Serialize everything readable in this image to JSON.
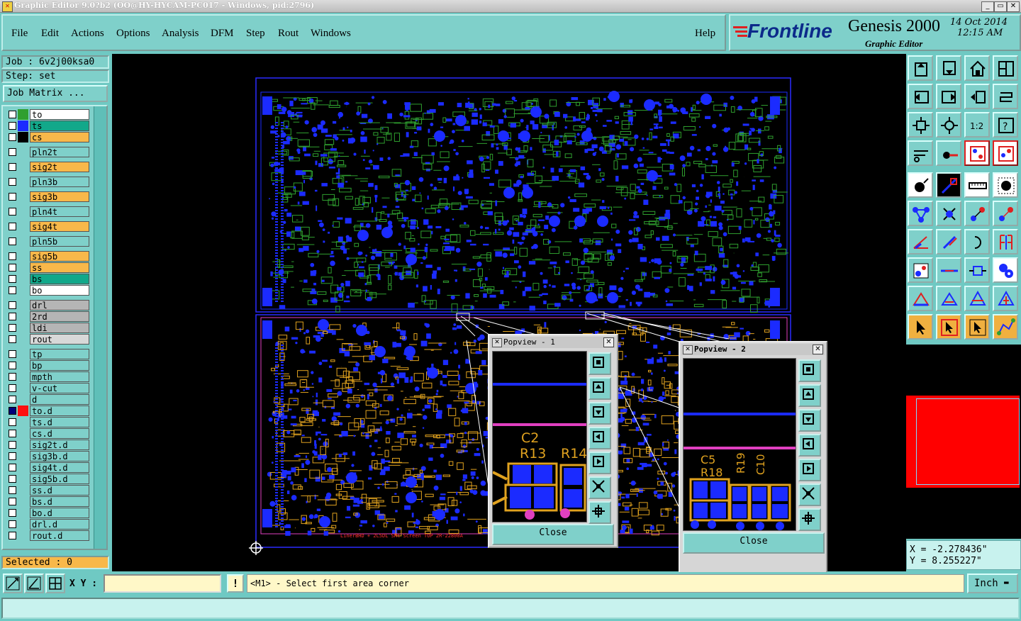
{
  "window": {
    "title": "Graphic Editor 9.0?b2 (OO@HY-HYCAM-PC017 - Windows, pid:2796)"
  },
  "menu": {
    "items": [
      "File",
      "Edit",
      "Actions",
      "Options",
      "Analysis",
      "DFM",
      "Step",
      "Rout",
      "Windows"
    ],
    "help": "Help"
  },
  "brand": {
    "logo": "Frontline",
    "product": "Genesis 2000",
    "subtitle": "Graphic Editor",
    "date": "14 Oct 2014",
    "time": "12:15 AM"
  },
  "job": {
    "job_label": "Job : 6v2j00ksa0",
    "step_label": "Step: set",
    "matrix_button": "Job Matrix ..."
  },
  "layers": [
    {
      "name": "to",
      "color": "#ffffff",
      "swatch": "#2f9f2f",
      "checked": false
    },
    {
      "name": "ts",
      "color": "#12a88a",
      "swatch": "#1b2bff",
      "checked": false
    },
    {
      "name": "cs",
      "color": "#f8b84a",
      "swatch": "#000000",
      "checked": false
    },
    {
      "name": "pln2t",
      "color": "#7fd0ca",
      "swatch": "",
      "checked": false
    },
    {
      "name": "sig2t",
      "color": "#f8b84a",
      "swatch": "",
      "checked": false
    },
    {
      "name": "pln3b",
      "color": "#7fd0ca",
      "swatch": "",
      "checked": false
    },
    {
      "name": "sig3b",
      "color": "#f8b84a",
      "swatch": "",
      "checked": false
    },
    {
      "name": "pln4t",
      "color": "#7fd0ca",
      "swatch": "",
      "checked": false
    },
    {
      "name": "sig4t",
      "color": "#f8b84a",
      "swatch": "",
      "checked": false
    },
    {
      "name": "pln5b",
      "color": "#7fd0ca",
      "swatch": "",
      "checked": false
    },
    {
      "name": "sig5b",
      "color": "#f8b84a",
      "swatch": "",
      "checked": false
    },
    {
      "name": "ss",
      "color": "#f8b84a",
      "swatch": "",
      "checked": false
    },
    {
      "name": "bs",
      "color": "#12a88a",
      "swatch": "",
      "checked": false
    },
    {
      "name": "bo",
      "color": "#ffffff",
      "swatch": "",
      "checked": false
    },
    {
      "name": "drl",
      "color": "#b5b5b5",
      "swatch": "",
      "checked": false
    },
    {
      "name": "2rd",
      "color": "#b5b5b5",
      "swatch": "",
      "checked": false
    },
    {
      "name": "ldi",
      "color": "#b5b5b5",
      "swatch": "",
      "checked": false
    },
    {
      "name": "rout",
      "color": "#d8d8d8",
      "swatch": "",
      "checked": false
    },
    {
      "name": "tp",
      "color": "#7fd0ca",
      "swatch": "",
      "checked": false
    },
    {
      "name": "bp",
      "color": "#7fd0ca",
      "swatch": "",
      "checked": false
    },
    {
      "name": "mpth",
      "color": "#7fd0ca",
      "swatch": "",
      "checked": false
    },
    {
      "name": "v-cut",
      "color": "#7fd0ca",
      "swatch": "",
      "checked": false
    },
    {
      "name": "d",
      "color": "#7fd0ca",
      "swatch": "",
      "checked": false
    },
    {
      "name": "to.d",
      "color": "#7fd0ca",
      "swatch": "#ff1010",
      "checked": true
    },
    {
      "name": "ts.d",
      "color": "#7fd0ca",
      "swatch": "",
      "checked": false
    },
    {
      "name": "cs.d",
      "color": "#7fd0ca",
      "swatch": "",
      "checked": false
    },
    {
      "name": "sig2t.d",
      "color": "#7fd0ca",
      "swatch": "",
      "checked": false
    },
    {
      "name": "sig3b.d",
      "color": "#7fd0ca",
      "swatch": "",
      "checked": false
    },
    {
      "name": "sig4t.d",
      "color": "#7fd0ca",
      "swatch": "",
      "checked": false
    },
    {
      "name": "sig5b.d",
      "color": "#7fd0ca",
      "swatch": "",
      "checked": false
    },
    {
      "name": "ss.d",
      "color": "#7fd0ca",
      "swatch": "",
      "checked": false
    },
    {
      "name": "bs.d",
      "color": "#7fd0ca",
      "swatch": "",
      "checked": false
    },
    {
      "name": "bo.d",
      "color": "#7fd0ca",
      "swatch": "",
      "checked": false
    },
    {
      "name": "drl.d",
      "color": "#7fd0ca",
      "swatch": "",
      "checked": false
    },
    {
      "name": "rout.d",
      "color": "#7fd0ca",
      "swatch": "",
      "checked": false
    }
  ],
  "selected": "Selected : 0",
  "popview1": {
    "title": "Popview - 1",
    "labels": [
      "C2",
      "R13",
      "R14"
    ],
    "close": "Close"
  },
  "popview2": {
    "title": "Popview - 2",
    "labels": [
      "C5",
      "R18",
      "R19",
      "C10"
    ],
    "close": "Close"
  },
  "canvas_text": {
    "footer": "LinerBHD + 2L5DL  SMt Screen TOP 2R-22800A"
  },
  "coords": {
    "x": "X = -2.278436\"",
    "y": "Y = 8.255227\""
  },
  "prompt": {
    "xy_label": "X Y :",
    "xy_value": "",
    "info": "!",
    "message": "<M1> - Select first area corner",
    "units": "Inch"
  },
  "colors": {
    "panel": "#7fd0ca",
    "accent_orange": "#f8b84a",
    "copper_blue": "#1b2bff",
    "silk_green": "#2f9f2f",
    "pad_orange": "#e0a21f",
    "highlight_magenta": "#e040c0",
    "overview_red": "#ff0000"
  }
}
